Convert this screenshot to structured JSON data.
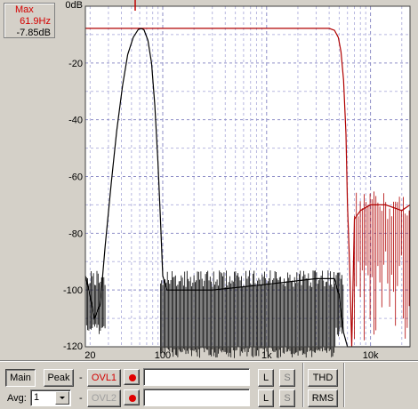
{
  "readout": {
    "label": "Max",
    "frequency": "61.9Hz",
    "level": "-7.85dB"
  },
  "chart_data": {
    "type": "line",
    "title": "",
    "xlabel": "",
    "ylabel": "",
    "x_scale": "log",
    "xlim": [
      18,
      24000
    ],
    "ylim": [
      -120,
      0
    ],
    "x_ticks": [
      {
        "value": 20,
        "label": "20"
      },
      {
        "value": 100,
        "label": "100"
      },
      {
        "value": 1000,
        "label": "1k"
      },
      {
        "value": 10000,
        "label": "10k"
      }
    ],
    "y_ticks": [
      {
        "value": 0,
        "label": "0dB"
      },
      {
        "value": -20,
        "label": "-20"
      },
      {
        "value": -40,
        "label": "-40"
      },
      {
        "value": -60,
        "label": "-60"
      },
      {
        "value": -80,
        "label": "-80"
      },
      {
        "value": -100,
        "label": "-100"
      },
      {
        "value": -120,
        "label": "-120"
      }
    ],
    "grid": true,
    "series": [
      {
        "color": "#b00000",
        "points": [
          [
            18,
            -7.8
          ],
          [
            100,
            -7.8
          ],
          [
            1000,
            -7.8
          ],
          [
            4000,
            -7.8
          ],
          [
            4500,
            -8.5
          ],
          [
            4900,
            -11
          ],
          [
            5200,
            -16
          ],
          [
            5500,
            -26
          ],
          [
            5800,
            -45
          ],
          [
            6000,
            -70
          ],
          [
            6300,
            -92
          ],
          [
            6600,
            -120
          ],
          [
            7000,
            -75
          ],
          [
            8000,
            -72
          ],
          [
            10000,
            -70
          ],
          [
            14000,
            -70
          ],
          [
            20000,
            -72
          ],
          [
            24000,
            -70
          ]
        ]
      },
      {
        "color": "#000000",
        "points": [
          [
            18,
            -95
          ],
          [
            20,
            -102
          ],
          [
            22,
            -110
          ],
          [
            25,
            -105
          ],
          [
            28,
            -84
          ],
          [
            32,
            -62
          ],
          [
            36,
            -44
          ],
          [
            41,
            -28
          ],
          [
            46,
            -17
          ],
          [
            52,
            -11
          ],
          [
            58,
            -8.2
          ],
          [
            61.9,
            -7.85
          ],
          [
            66,
            -8.3
          ],
          [
            72,
            -12
          ],
          [
            78,
            -20
          ],
          [
            84,
            -35
          ],
          [
            90,
            -55
          ],
          [
            95,
            -75
          ],
          [
            100,
            -95
          ],
          [
            110,
            -100
          ],
          [
            300,
            -100
          ],
          [
            1000,
            -98
          ],
          [
            3000,
            -96
          ],
          [
            4500,
            -96
          ],
          [
            5000,
            -102
          ],
          [
            5500,
            -115
          ],
          [
            6000,
            -120
          ],
          [
            24000,
            -120
          ]
        ]
      }
    ]
  },
  "controls": {
    "main_label": "Main",
    "peak_label": "Peak",
    "dash1": "-",
    "dash2": "-",
    "ovl1_label": "OVL1",
    "ovl2_label": "OVL2",
    "l1_label": "L",
    "s1_label": "S",
    "l2_label": "L",
    "s2_label": "S",
    "thd_label": "THD",
    "rms_label": "RMS",
    "avg_label": "Avg:",
    "avg_value": "1",
    "record_color": "#e00000"
  }
}
